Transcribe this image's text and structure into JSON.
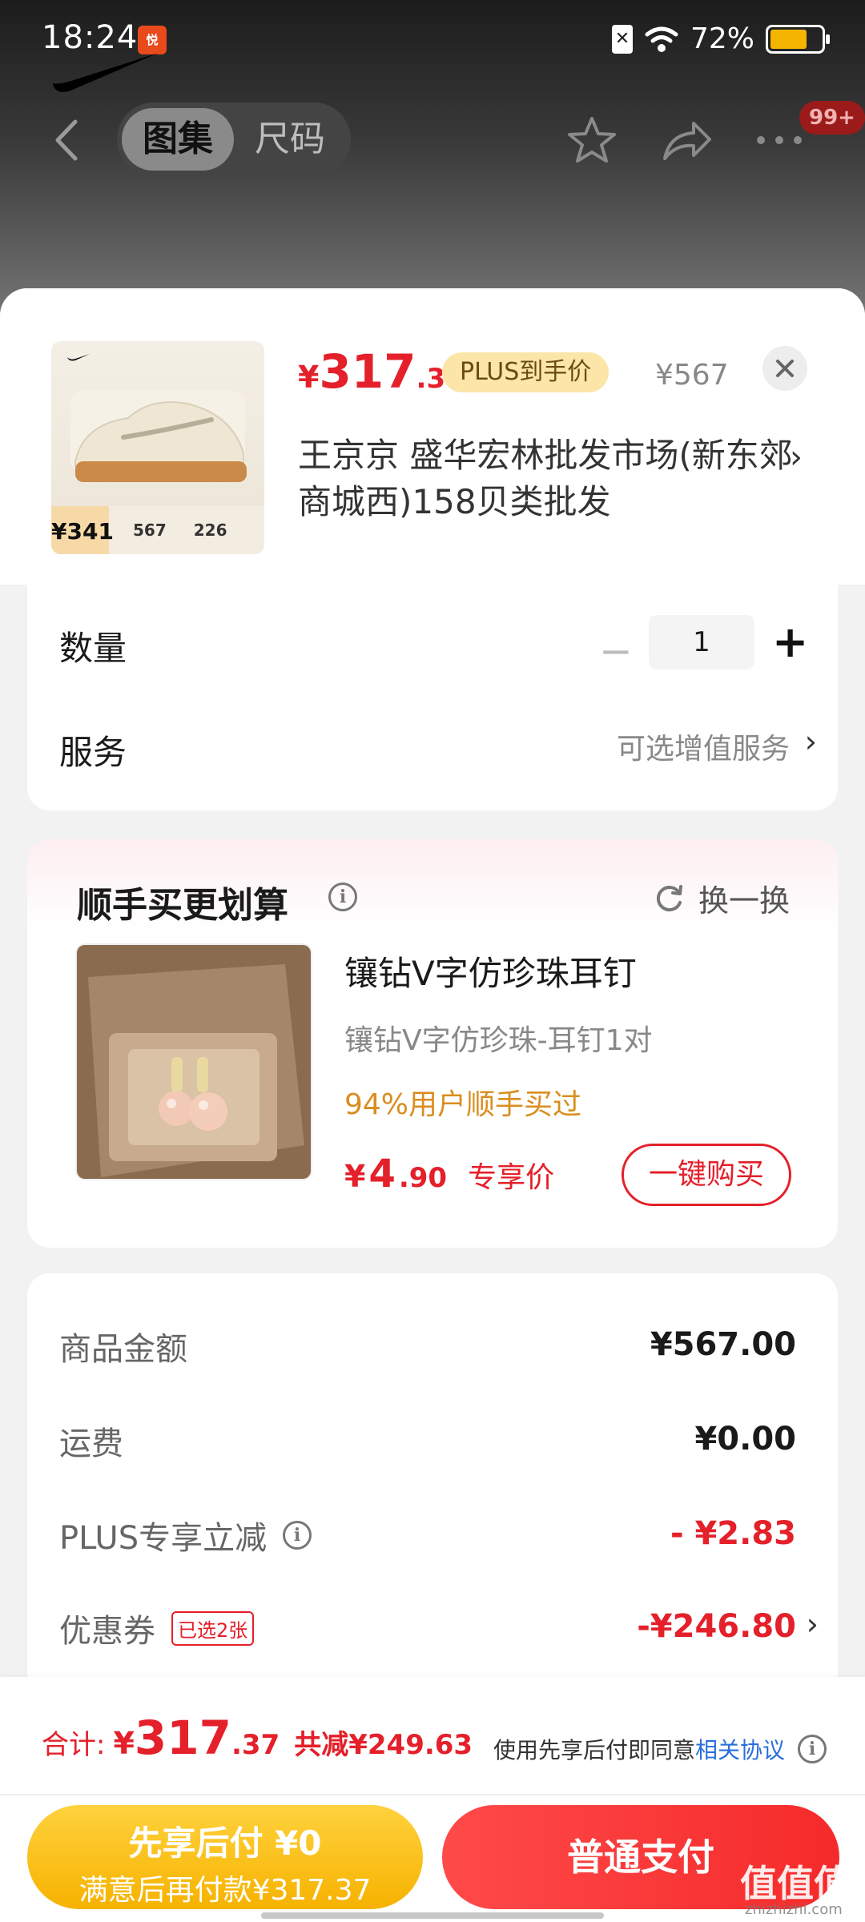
{
  "status_bar": {
    "time": "18:24",
    "app_icon_text": "悦",
    "battery": "72%",
    "battery_level": 0.72
  },
  "nav": {
    "tabs": [
      {
        "label": "图集",
        "active": true
      },
      {
        "label": "尺码",
        "active": false
      }
    ],
    "badge": "99+",
    "icons": [
      "back-icon",
      "star-icon",
      "share-icon",
      "more-icon"
    ]
  },
  "product": {
    "price_symbol": "¥",
    "price_int": "317",
    "price_dec": ".37",
    "plus_badge": "PLUS到手价",
    "original_price": "¥567",
    "store_name": "王京京  盛华宏林批发市场(新东郊商城西)158贝类批发",
    "thumb": {
      "price_label": "¥341",
      "stat_a": "567",
      "stat_b": "226"
    }
  },
  "quantity": {
    "label": "数量",
    "value": "1",
    "minus": "−",
    "plus": "+"
  },
  "service": {
    "label": "服务",
    "hint": "可选增值服务"
  },
  "addon": {
    "title": "顺手买更划算",
    "refresh_label": "换一换",
    "name": "镶钻V字仿珍珠耳钉",
    "spec": "镶钻V字仿珍珠-耳钉1对",
    "social_proof": "94%用户顺手买过",
    "price_symbol": "¥",
    "price_int": "4",
    "price_dec": ".90",
    "price_tag": "专享价",
    "buy_label": "一键购买"
  },
  "summary": {
    "rows": [
      {
        "label": "商品金额",
        "value": "¥567.00"
      },
      {
        "label": "运费",
        "value": "¥0.00"
      },
      {
        "label": "PLUS专享立减",
        "value": "- ¥2.83"
      },
      {
        "label": "优惠券",
        "tag": "已选2张",
        "value": "-¥246.80"
      }
    ]
  },
  "footer": {
    "total_label": "合计:",
    "total_symbol": "¥",
    "total_int": "317",
    "total_dec": ".37",
    "total_saved": "共减¥249.63",
    "agree_text": "使用先享后付即同意",
    "agree_link": "相关协议",
    "btn_later_line1": "先享后付 ¥0",
    "btn_later_line2": "满意后再付款¥317.37",
    "btn_pay": "普通支付",
    "watermark": "值值值",
    "watermark_sub": "zhizhizhi.com"
  },
  "colors": {
    "accent_red": "#e4202a",
    "plus_gold": "#fbe6a8",
    "later_yellow": "#f6b200",
    "social_orange": "#d98e1e"
  }
}
